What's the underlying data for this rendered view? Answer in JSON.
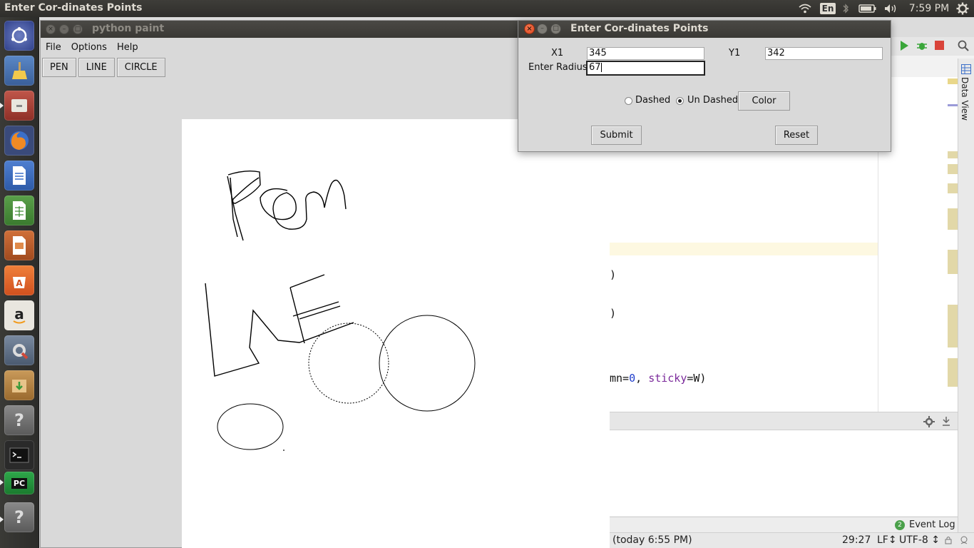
{
  "topbar": {
    "title": "Enter Cor-dinates Points",
    "keyboard_layout": "En",
    "clock": "7:59 PM"
  },
  "paint_window": {
    "title": "python paint",
    "menu": [
      "File",
      "Options",
      "Help"
    ],
    "tools": [
      "PEN",
      "LINE",
      "CIRCLE"
    ]
  },
  "dialog": {
    "title": "Enter Cor-dinates Points",
    "x1_label": "X1",
    "x1_value": "345",
    "y1_label": "Y1",
    "y1_value": "342",
    "radius_label": "Enter Radius",
    "radius_value": "67",
    "dashed_label": "Dashed",
    "undashed_label": "Un Dashed",
    "selected_style": "Un Dashed",
    "color_label": "Color",
    "submit_label": "Submit",
    "reset_label": "Reset"
  },
  "ide": {
    "code_fragment_1": ")",
    "code_fragment_2": ")",
    "code_line_prefix": "mn=",
    "code_line_num": "0",
    "code_line_mid": ", ",
    "code_line_kw": "sticky",
    "code_line_suffix": "=W)",
    "data_view_label": "Data View",
    "event_log_badge": "2",
    "event_log_label": "Event Log",
    "status_left": "(today 6:55 PM)",
    "status_position": "29:27",
    "status_lf": "LF↕",
    "status_encoding": "UTF-8 ↕"
  },
  "colors": {
    "accent_close": "#e2532a",
    "panel": "#3c3b37",
    "canvas": "#ffffff"
  }
}
